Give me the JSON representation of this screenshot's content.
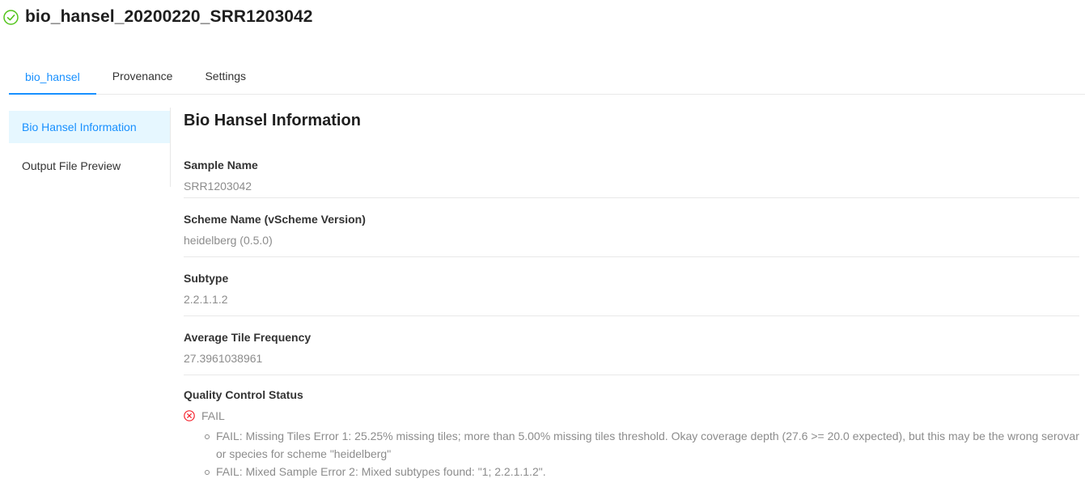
{
  "header": {
    "title": "bio_hansel_20200220_SRR1203042",
    "status_icon": "check-circle-icon",
    "status_color": "#52c41a"
  },
  "tabs": [
    {
      "label": "bio_hansel",
      "active": true
    },
    {
      "label": "Provenance",
      "active": false
    },
    {
      "label": "Settings",
      "active": false
    }
  ],
  "side_menu": [
    {
      "label": "Bio Hansel Information",
      "active": true
    },
    {
      "label": "Output File Preview",
      "active": false
    }
  ],
  "content": {
    "title": "Bio Hansel Information",
    "fields": [
      {
        "label": "Sample Name",
        "value": "SRR1203042"
      },
      {
        "label": "Scheme Name (vScheme Version)",
        "value": "heidelberg (0.5.0)"
      },
      {
        "label": "Subtype",
        "value": "2.2.1.1.2"
      },
      {
        "label": "Average Tile Frequency",
        "value": "27.3961038961"
      }
    ],
    "qc": {
      "label": "Quality Control Status",
      "status": "FAIL",
      "status_icon": "close-circle-icon",
      "status_color": "#f5222d",
      "messages": [
        "FAIL: Missing Tiles Error 1: 25.25% missing tiles; more than 5.00% missing tiles threshold. Okay coverage depth (27.6 >= 20.0 expected), but this may be the wrong serovar or species for scheme \"heidelberg\"",
        "FAIL: Mixed Sample Error 2: Mixed subtypes found: \"1; 2.2.1.1.2\"."
      ]
    }
  }
}
